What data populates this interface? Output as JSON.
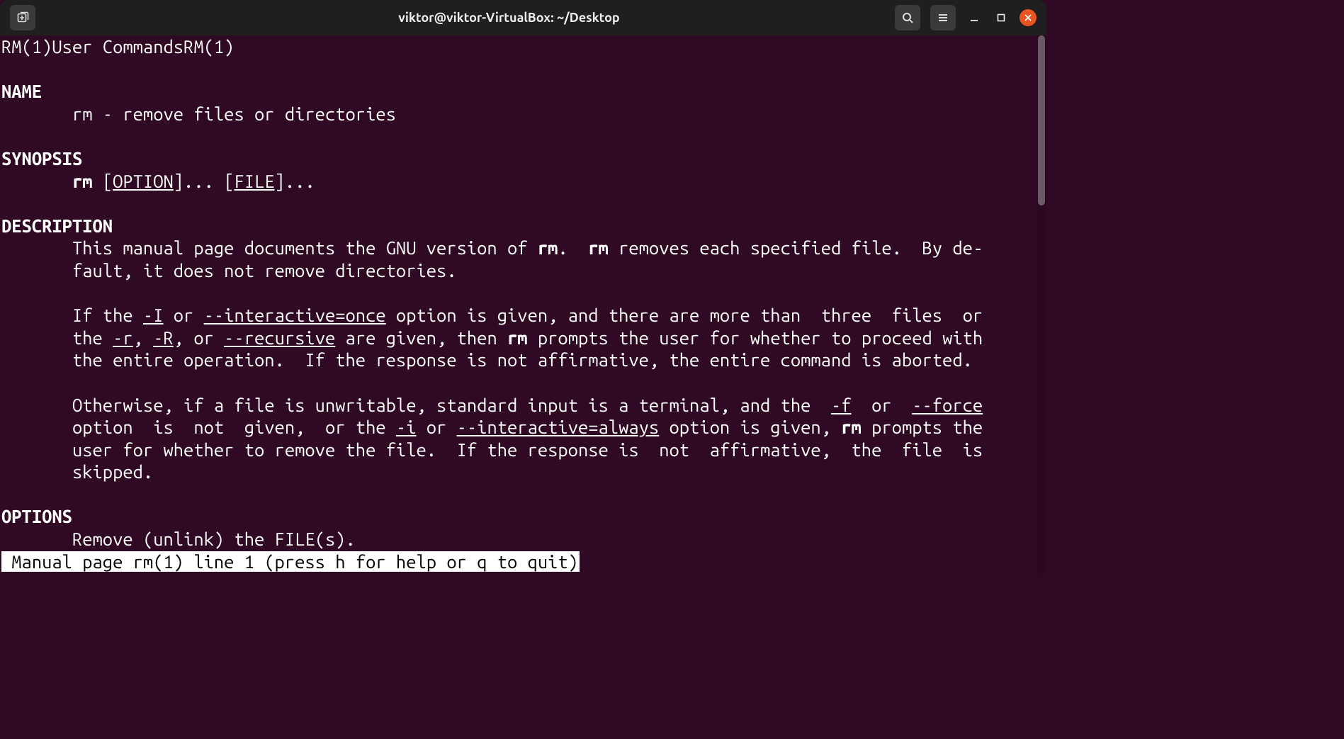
{
  "titlebar": {
    "title": "viktor@viktor-VirtualBox: ~/Desktop"
  },
  "man": {
    "header_left": "RM(1)",
    "header_center": "User Commands",
    "header_right": "RM(1)",
    "sections": {
      "name": "NAME",
      "synopsis": "SYNOPSIS",
      "description": "DESCRIPTION",
      "options": "OPTIONS"
    },
    "name_line": "rm - remove files or directories",
    "synopsis": {
      "cmd": "rm",
      "lb1": " [",
      "opt": "OPTION",
      "rb1": "]... [",
      "file": "FILE",
      "tail": "]..."
    },
    "desc": {
      "p1a": "This manual page documents the GNU version of ",
      "rm1": "rm",
      "p1b": ".  ",
      "rm2": "rm",
      "p1c": " removes each specified file.  By de‐",
      "p1d": "fault, it does not remove directories.",
      "p2a": "If the ",
      "optI": "-I",
      "p2b": " or ",
      "optIntOnce": "--interactive=once",
      "p2c": " option is given, and there are more than  three  files  or",
      "p2d": "the ",
      "optr": "-r",
      "p2e": ", ",
      "optR": "-R",
      "p2f": ", or ",
      "optRec": "--recursive",
      "p2g": " are given, then ",
      "rm3": "rm",
      "p2h": " prompts the user for whether to proceed with",
      "p2i": "the entire operation.  If the response is not affirmative, the entire command is aborted.",
      "p3a": "Otherwise, if a file is unwritable, standard input is a terminal, and the  ",
      "optf": "-f",
      "p3b": "  or  ",
      "optForce": "--force",
      "p3c": "option  is  not  given,  or the ",
      "opti": "-i",
      "p3d": " or ",
      "optIntAlways": "--interactive=always",
      "p3e": " option is given, ",
      "rm4": "rm",
      "p3f": " prompts the",
      "p3g": "user for whether to remove the file.  If the response is  not  affirmative,  the  file  is",
      "p3h": "skipped."
    },
    "options_line": "Remove (unlink) the FILE(s).",
    "status": " Manual page rm(1) line 1 (press h for help or q to quit)"
  }
}
